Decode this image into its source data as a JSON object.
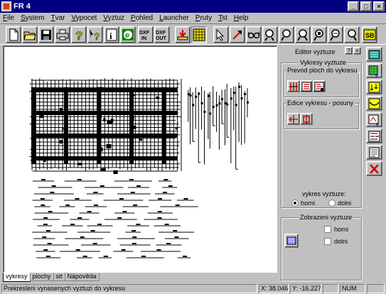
{
  "window": {
    "title": "FR 4",
    "buttons": [
      "_",
      "□",
      "×"
    ]
  },
  "menu": [
    "File",
    "System",
    "Tvar",
    "Vypocet",
    "Vyztuz",
    "Pohled",
    "Launcher",
    "Pruty",
    "Tst",
    "Help"
  ],
  "toolbar": {
    "buttons": [
      {
        "name": "new-file",
        "label": ""
      },
      {
        "name": "open-folder",
        "label": ""
      },
      {
        "name": "save",
        "label": ""
      },
      {
        "name": "print",
        "label": ""
      },
      {
        "name": "help",
        "label": ""
      },
      {
        "name": "context-help",
        "label": ""
      },
      {
        "name": "info",
        "label": ""
      },
      {
        "name": "e-toggle",
        "label": ""
      },
      {
        "name": "dxf-in",
        "label": "DXF\nIN"
      },
      {
        "name": "dxf-out",
        "label": "DXF\nOUT"
      },
      {
        "name": "insert",
        "label": ""
      },
      {
        "name": "grid",
        "label": ""
      },
      {
        "name": "select-arrow",
        "label": ""
      },
      {
        "name": "draw-arrow",
        "label": ""
      },
      {
        "name": "glasses",
        "label": ""
      },
      {
        "name": "zoom-1",
        "label": ""
      },
      {
        "name": "zoom-2",
        "label": ""
      },
      {
        "name": "zoom-3",
        "label": ""
      },
      {
        "name": "zoom-4",
        "label": ""
      },
      {
        "name": "zoom-5",
        "label": ""
      },
      {
        "name": "zoom-6",
        "label": ""
      },
      {
        "name": "sb",
        "label": "SB"
      }
    ]
  },
  "panel": {
    "title": "Editor vyztuze",
    "help_btn": "?",
    "close_btn": "×",
    "group_vykresy": "Vykresy vyztuze",
    "sub_prevod": "Prevod ploch do vykresu",
    "sub_edice": "Edice vykresu - posuny",
    "vykres_label": "vykres vyztuze:",
    "radio_horni": "horni",
    "radio_dolni": "dolni",
    "group_zobrazeni": "Zobrazeni vyztuze",
    "chk_horni": "horni",
    "chk_dolni": "dolni"
  },
  "tabs": [
    "vykresy",
    "plochy",
    "sit",
    "Nápověda"
  ],
  "status": {
    "message": "Prekresleni vynasenych vyztuzi do vykresu",
    "x": "X: 38.046",
    "y": "Y: -16.227",
    "blank": "",
    "num": "NUM",
    "tail": ""
  },
  "colors": {
    "titlebar": "#000080",
    "face": "#c0c0c0",
    "accent_red": "#d00000",
    "accent_green": "#008000",
    "accent_yellow": "#ffff00"
  }
}
